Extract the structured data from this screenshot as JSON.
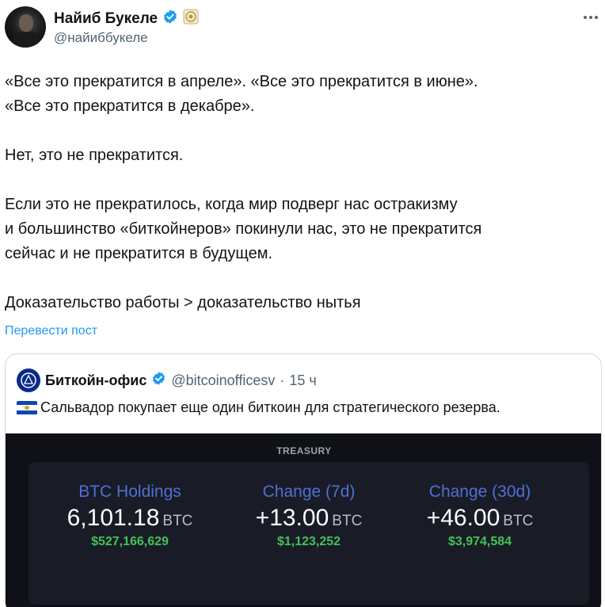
{
  "author": {
    "display_name": "Найиб Букеле",
    "handle": "@найиббукеле"
  },
  "tweet": {
    "paragraphs": [
      "«Все это прекратится в апреле». «Все это прекратится в июне».\n«Все это прекратится в декабре».",
      "Нет, это не прекратится.",
      "Если это не прекратилось, когда мир подверг нас остракизму\nи большинство «биткойнеров» покинули нас, это не прекратится\nсейчас и не прекратится в будущем.",
      "Доказательство работы > доказательство нытья"
    ],
    "translate_label": "Перевести пост"
  },
  "quote": {
    "name": "Биткойн-офис",
    "handle": "@bitcoinofficesv",
    "separator": "·",
    "time": "15 ч",
    "text": "Сальвадор покупает еще один биткоин для стратегического резерва.",
    "media": {
      "title": "TREASURY",
      "stats": [
        {
          "label": "BTC Holdings",
          "value": "6,101.18",
          "unit": "BTC",
          "usd": "$527,166,629"
        },
        {
          "label": "Change (7d)",
          "value": "+13.00",
          "unit": "BTC",
          "usd": "$1,123,252"
        },
        {
          "label": "Change (30d)",
          "value": "+46.00",
          "unit": "BTC",
          "usd": "$3,974,584"
        }
      ]
    }
  },
  "colors": {
    "link": "#1d9bf0",
    "verified": "#1d9bf0",
    "stat_label": "#4f6fd6",
    "usd_green": "#44c157",
    "media_bg": "#0f1117"
  },
  "icons": [
    "more-icon",
    "verified-badge-icon",
    "government-badge-icon",
    "el-salvador-flag-icon",
    "bitcoin-office-seal-icon"
  ]
}
